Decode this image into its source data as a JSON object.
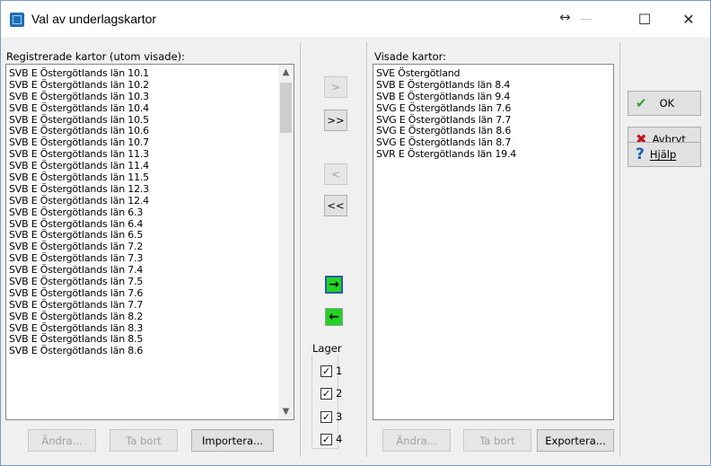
{
  "window": {
    "title": "Val av underlagskartor",
    "resize_glyph": "↔",
    "maximize_glyph": "☐",
    "close_glyph": "✕"
  },
  "left_panel": {
    "label": "Registrerade kartor (utom visade):",
    "items": [
      "SVB E Östergötlands län 10.1",
      "SVB E Östergötlands län 10.2",
      "SVB E Östergötlands län 10.3",
      "SVB E Östergötlands län 10.4",
      "SVB E Östergötlands län 10.5",
      "SVB E Östergötlands län 10.6",
      "SVB E Östergötlands län 10.7",
      "SVB E Östergötlands län 11.3",
      "SVB E Östergötlands län 11.4",
      "SVB E Östergötlands län 11.5",
      "SVB E Östergötlands län 12.3",
      "SVB E Östergötlands län 12.4",
      "SVB E Östergötlands län 6.3",
      "SVB E Östergötlands län 6.4",
      "SVB E Östergötlands län 6.5",
      "SVB E Östergötlands län 7.2",
      "SVB E Östergötlands län 7.3",
      "SVB E Östergötlands län 7.4",
      "SVB E Östergötlands län 7.5",
      "SVB E Östergötlands län 7.6",
      "SVB E Östergötlands län 7.7",
      "SVB E Östergötlands län 8.2",
      "SVB E Östergötlands län 8.3",
      "SVB E Östergötlands län 8.5",
      "SVB E Östergötlands län 8.6"
    ],
    "buttons": {
      "edit": "Ändra...",
      "remove": "Ta bort",
      "import": "Importera..."
    }
  },
  "middle": {
    "move_right": ">",
    "move_all_right": ">>",
    "move_left": "<",
    "move_all_left": "<<",
    "layer_group_label": "Lager",
    "layers": [
      {
        "label": "1",
        "checked": true
      },
      {
        "label": "2",
        "checked": true
      },
      {
        "label": "3",
        "checked": true
      },
      {
        "label": "4",
        "checked": true
      }
    ]
  },
  "right_panel": {
    "label": "Visade kartor:",
    "items": [
      "SVE Östergötland",
      "SVB E Östergötlands län 8.4",
      "SVB E Östergötlands län 9.4",
      "SVG E Östergötlands län 7.6",
      "SVG E Östergötlands län 7.7",
      "SVG E Östergötlands län 8.6",
      "SVG E Östergötlands län 8.7",
      "SVR E Östergötlands län 19.4"
    ],
    "buttons": {
      "edit": "Ändra...",
      "remove": "Ta bort",
      "export": "Exportera..."
    }
  },
  "actions": {
    "ok": "OK",
    "cancel": "Avbryt",
    "help": "Hjälp",
    "ok_icon": "✔",
    "cancel_icon": "✖",
    "help_icon": "?"
  },
  "colors": {
    "ok_icon": "#2e9e2e",
    "cancel_icon": "#c0141e",
    "help_icon": "#1a5fb4",
    "arrow_button_fill": "#22d322"
  }
}
